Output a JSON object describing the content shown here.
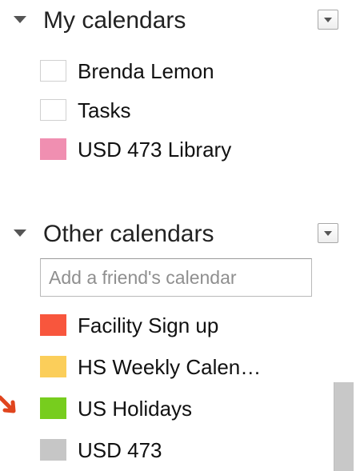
{
  "my_calendars": {
    "title": "My calendars",
    "items": [
      {
        "label": "Brenda Lemon",
        "color": "#ffffff",
        "checked": false
      },
      {
        "label": "Tasks",
        "color": "#ffffff",
        "checked": false
      },
      {
        "label": "USD 473 Library",
        "color": "#f08fb1",
        "checked": true
      }
    ]
  },
  "other_calendars": {
    "title": "Other calendars",
    "add_friend_placeholder": "Add a friend's calendar",
    "items": [
      {
        "label": "Facility Sign up",
        "color": "#f8563d",
        "checked": true
      },
      {
        "label": "HS Weekly Calen…",
        "color": "#fbce5a",
        "checked": true
      },
      {
        "label": "US Holidays",
        "color": "#77cd1e",
        "checked": true
      },
      {
        "label": "USD 473",
        "color": "#c6c6c6",
        "checked": true
      }
    ]
  },
  "annotation": {
    "arrow_color": "#e0451e"
  }
}
